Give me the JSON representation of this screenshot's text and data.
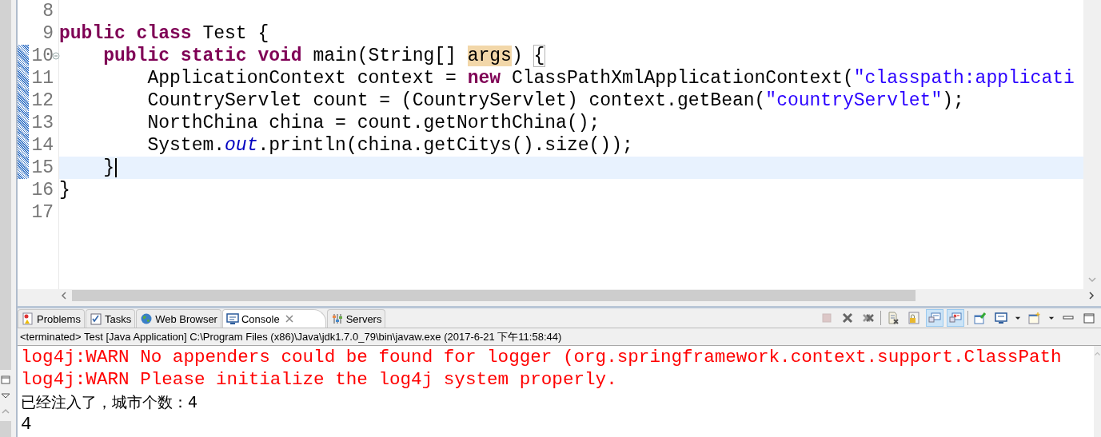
{
  "editor": {
    "lines": [
      {
        "number": "8",
        "range_marked": false,
        "current": false,
        "foldable": false
      },
      {
        "number": "9",
        "tokens": [
          {
            "kind": "keyword",
            "text": "public class "
          },
          {
            "kind": "plain",
            "text": "Test {"
          }
        ],
        "range_marked": false,
        "current": false,
        "foldable": false
      },
      {
        "number": "10",
        "tokens": [
          {
            "kind": "keyword",
            "text": "    public static void "
          },
          {
            "kind": "plain",
            "text": "main(String[] "
          },
          {
            "kind": "occurrence",
            "text": "args"
          },
          {
            "kind": "plain",
            "text": ") "
          },
          {
            "kind": "bracket_match",
            "text": "{"
          }
        ],
        "range_marked": true,
        "current": false,
        "foldable": true
      },
      {
        "number": "11",
        "tokens": [
          {
            "kind": "plain",
            "text": "        ApplicationContext context = "
          },
          {
            "kind": "keyword",
            "text": "new"
          },
          {
            "kind": "plain",
            "text": " ClassPathXmlApplicationContext("
          },
          {
            "kind": "string",
            "text": "\"classpath:applicati"
          }
        ],
        "range_marked": true,
        "current": false,
        "foldable": false
      },
      {
        "number": "12",
        "tokens": [
          {
            "kind": "plain",
            "text": "        CountryServlet count = (CountryServlet) context.getBean("
          },
          {
            "kind": "string",
            "text": "\"countryServlet\""
          },
          {
            "kind": "plain",
            "text": ");"
          }
        ],
        "range_marked": true,
        "current": false,
        "foldable": false
      },
      {
        "number": "13",
        "tokens": [
          {
            "kind": "plain",
            "text": "        NorthChina china = count.getNorthChina();"
          }
        ],
        "range_marked": true,
        "current": false,
        "foldable": false
      },
      {
        "number": "14",
        "tokens": [
          {
            "kind": "plain",
            "text": "        System."
          },
          {
            "kind": "field",
            "text": "out"
          },
          {
            "kind": "plain",
            "text": ".println(china.getCitys().size());"
          }
        ],
        "range_marked": true,
        "current": false,
        "foldable": false
      },
      {
        "number": "15",
        "tokens": [
          {
            "kind": "plain",
            "text": "    }"
          }
        ],
        "range_marked": true,
        "current": true,
        "foldable": false
      },
      {
        "number": "16",
        "tokens": [
          {
            "kind": "plain",
            "text": "}"
          }
        ],
        "range_marked": false,
        "current": false,
        "foldable": false
      },
      {
        "number": "17",
        "range_marked": false,
        "current": false,
        "foldable": false
      }
    ]
  },
  "console": {
    "tabs": [
      {
        "label": "Problems",
        "selected": false,
        "closable": false
      },
      {
        "label": "Tasks",
        "selected": false,
        "closable": false
      },
      {
        "label": "Web Browser",
        "selected": false,
        "closable": false
      },
      {
        "label": "Console",
        "selected": true,
        "closable": true
      },
      {
        "label": "Servers",
        "selected": false,
        "closable": false
      }
    ],
    "toolbar": [
      {
        "kind": "stop",
        "disabled": true,
        "pressed": false
      },
      {
        "kind": "remove",
        "disabled": false,
        "pressed": false
      },
      {
        "kind": "remove_all",
        "disabled": false,
        "pressed": false
      },
      {
        "kind": "separator"
      },
      {
        "kind": "clear",
        "disabled": false,
        "pressed": false
      },
      {
        "kind": "scroll_lock",
        "disabled": false,
        "pressed": false
      },
      {
        "kind": "show_out",
        "disabled": false,
        "pressed": true
      },
      {
        "kind": "show_err",
        "disabled": false,
        "pressed": true
      },
      {
        "kind": "separator"
      },
      {
        "kind": "pin",
        "disabled": false,
        "pressed": false
      },
      {
        "kind": "display",
        "disabled": false,
        "pressed": false
      },
      {
        "kind": "caret",
        "disabled": false,
        "pressed": false
      },
      {
        "kind": "new_console",
        "disabled": false,
        "pressed": false
      },
      {
        "kind": "caret",
        "disabled": false,
        "pressed": false
      },
      {
        "kind": "minimize",
        "disabled": false,
        "pressed": false
      },
      {
        "kind": "maximize",
        "disabled": false,
        "pressed": false
      }
    ],
    "status": "<terminated> Test [Java Application] C:\\Program Files (x86)\\Java\\jdk1.7.0_79\\bin\\javaw.exe (2017-6-21 下午11:58:44)",
    "output": [
      {
        "kind": "error",
        "text": "log4j:WARN No appenders could be found for logger (org.springframework.context.support.ClassPath"
      },
      {
        "kind": "error",
        "text": "log4j:WARN Please initialize the log4j system properly."
      },
      {
        "kind": "output",
        "text": "已经注入了，城市个数：4"
      },
      {
        "kind": "output",
        "text": "4"
      }
    ]
  }
}
